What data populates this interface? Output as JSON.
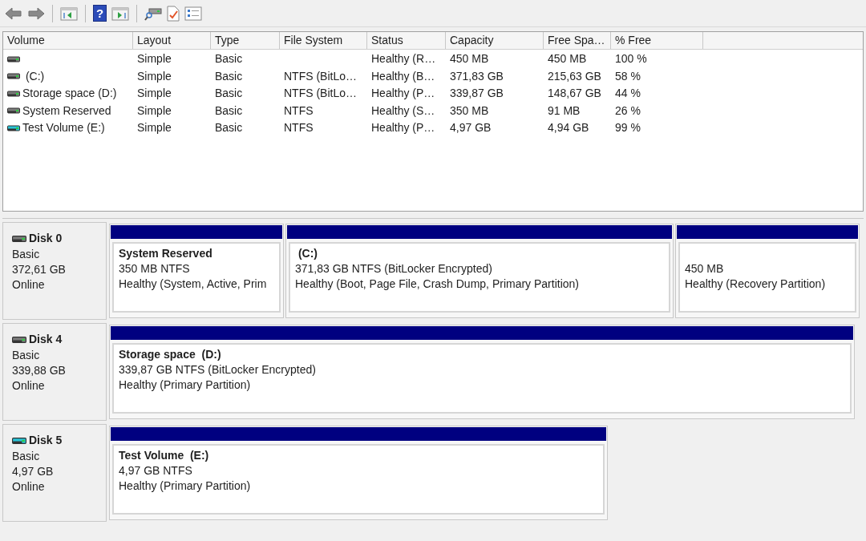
{
  "toolbar": [
    {
      "kind": "back"
    },
    {
      "kind": "forward"
    },
    {
      "kind": "sep"
    },
    {
      "kind": "tree"
    },
    {
      "kind": "sep"
    },
    {
      "kind": "help",
      "glyph": "?"
    },
    {
      "kind": "pane"
    },
    {
      "kind": "sep"
    },
    {
      "kind": "diskscan"
    },
    {
      "kind": "check"
    },
    {
      "kind": "props"
    }
  ],
  "table": {
    "columns": [
      "Volume",
      "Layout",
      "Type",
      "File System",
      "Status",
      "Capacity",
      "Free Spa…",
      "% Free"
    ],
    "rows": [
      {
        "kind": "fixed",
        "cells": [
          "",
          "Simple",
          "Basic",
          "",
          "Healthy (R…",
          "450 MB",
          "450 MB",
          "100 %"
        ]
      },
      {
        "kind": "fixed",
        "cells": [
          " (C:)",
          "Simple",
          "Basic",
          "NTFS (BitLo…",
          "Healthy (B…",
          "371,83 GB",
          "215,63 GB",
          "58 %"
        ]
      },
      {
        "kind": "fixed",
        "cells": [
          "Storage space (D:)",
          "Simple",
          "Basic",
          "NTFS (BitLo…",
          "Healthy (P…",
          "339,87 GB",
          "148,67 GB",
          "44 %"
        ]
      },
      {
        "kind": "fixed",
        "cells": [
          "System Reserved",
          "Simple",
          "Basic",
          "NTFS",
          "Healthy (S…",
          "350 MB",
          "91 MB",
          "26 %"
        ]
      },
      {
        "kind": "removable",
        "cells": [
          "Test Volume (E:)",
          "Simple",
          "Basic",
          "NTFS",
          "Healthy (P…",
          "4,97 GB",
          "4,94 GB",
          "99 %"
        ]
      }
    ]
  },
  "disks": [
    {
      "kind": "fixed",
      "name": "Disk 0",
      "type": "Basic",
      "size": "372,61 GB",
      "state": "Online",
      "partitions": [
        {
          "title": "System Reserved",
          "lines": [
            "350 MB NTFS",
            "Healthy (System, Active, Prim"
          ]
        },
        {
          "title": " (C:)",
          "lines": [
            "371,83 GB NTFS (BitLocker Encrypted)",
            "Healthy (Boot, Page File, Crash Dump, Primary Partition)"
          ]
        },
        {
          "lines": [
            "450 MB",
            "Healthy (Recovery Partition)"
          ]
        }
      ]
    },
    {
      "kind": "fixed",
      "name": "Disk 4",
      "type": "Basic",
      "size": "339,88 GB",
      "state": "Online",
      "partitions": [
        {
          "title": "Storage space  (D:)",
          "lines": [
            "339,87 GB NTFS (BitLocker Encrypted)",
            "Healthy (Primary Partition)"
          ]
        }
      ]
    },
    {
      "kind": "removable",
      "name": "Disk 5",
      "type": "Basic",
      "size": "4,97 GB",
      "state": "Online",
      "partitions": [
        {
          "title": "Test Volume  (E:)",
          "lines": [
            "4,97 GB NTFS",
            "Healthy (Primary Partition)"
          ]
        }
      ]
    }
  ]
}
